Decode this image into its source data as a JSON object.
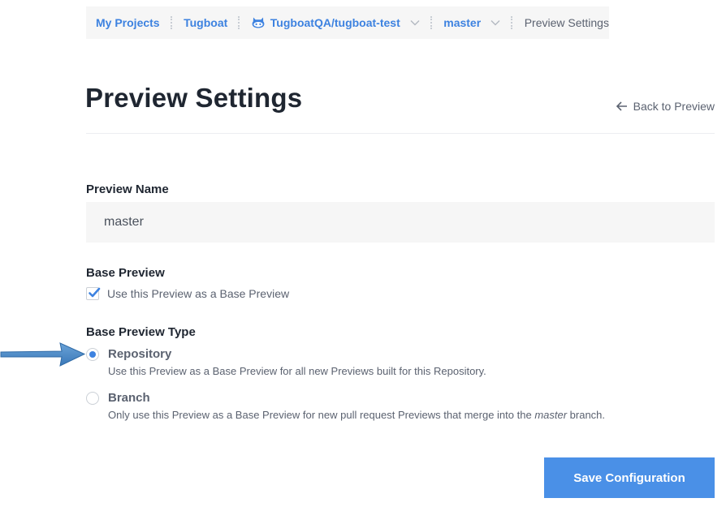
{
  "breadcrumb": {
    "my_projects": "My Projects",
    "project": "Tugboat",
    "repository": "TugboatQA/tugboat-test",
    "branch": "master",
    "current": "Preview Settings"
  },
  "header": {
    "title": "Preview Settings",
    "back_link": "Back to Preview"
  },
  "form": {
    "preview_name": {
      "label": "Preview Name",
      "value": "master"
    },
    "base_preview": {
      "label": "Base Preview",
      "checkbox_label": "Use this Preview as a Base Preview",
      "checked": true
    },
    "base_preview_type": {
      "label": "Base Preview Type",
      "options": [
        {
          "title": "Repository",
          "description": "Use this Preview as a Base Preview for all new Previews built for this Repository.",
          "selected": true
        },
        {
          "title": "Branch",
          "description_before": "Only use this Preview as a Base Preview for new pull request Previews that merge into the ",
          "description_emphasis": "master",
          "description_after": " branch.",
          "selected": false
        }
      ]
    },
    "save_label": "Save Configuration"
  },
  "colors": {
    "link_blue": "#3d82e0",
    "button_blue": "#4a90e7",
    "annotation_arrow": "#4a87c4"
  },
  "icons": {
    "repo": "github-octocat-icon",
    "chevron": "chevron-down-icon",
    "back": "arrow-left-icon",
    "check": "checkmark-icon"
  }
}
